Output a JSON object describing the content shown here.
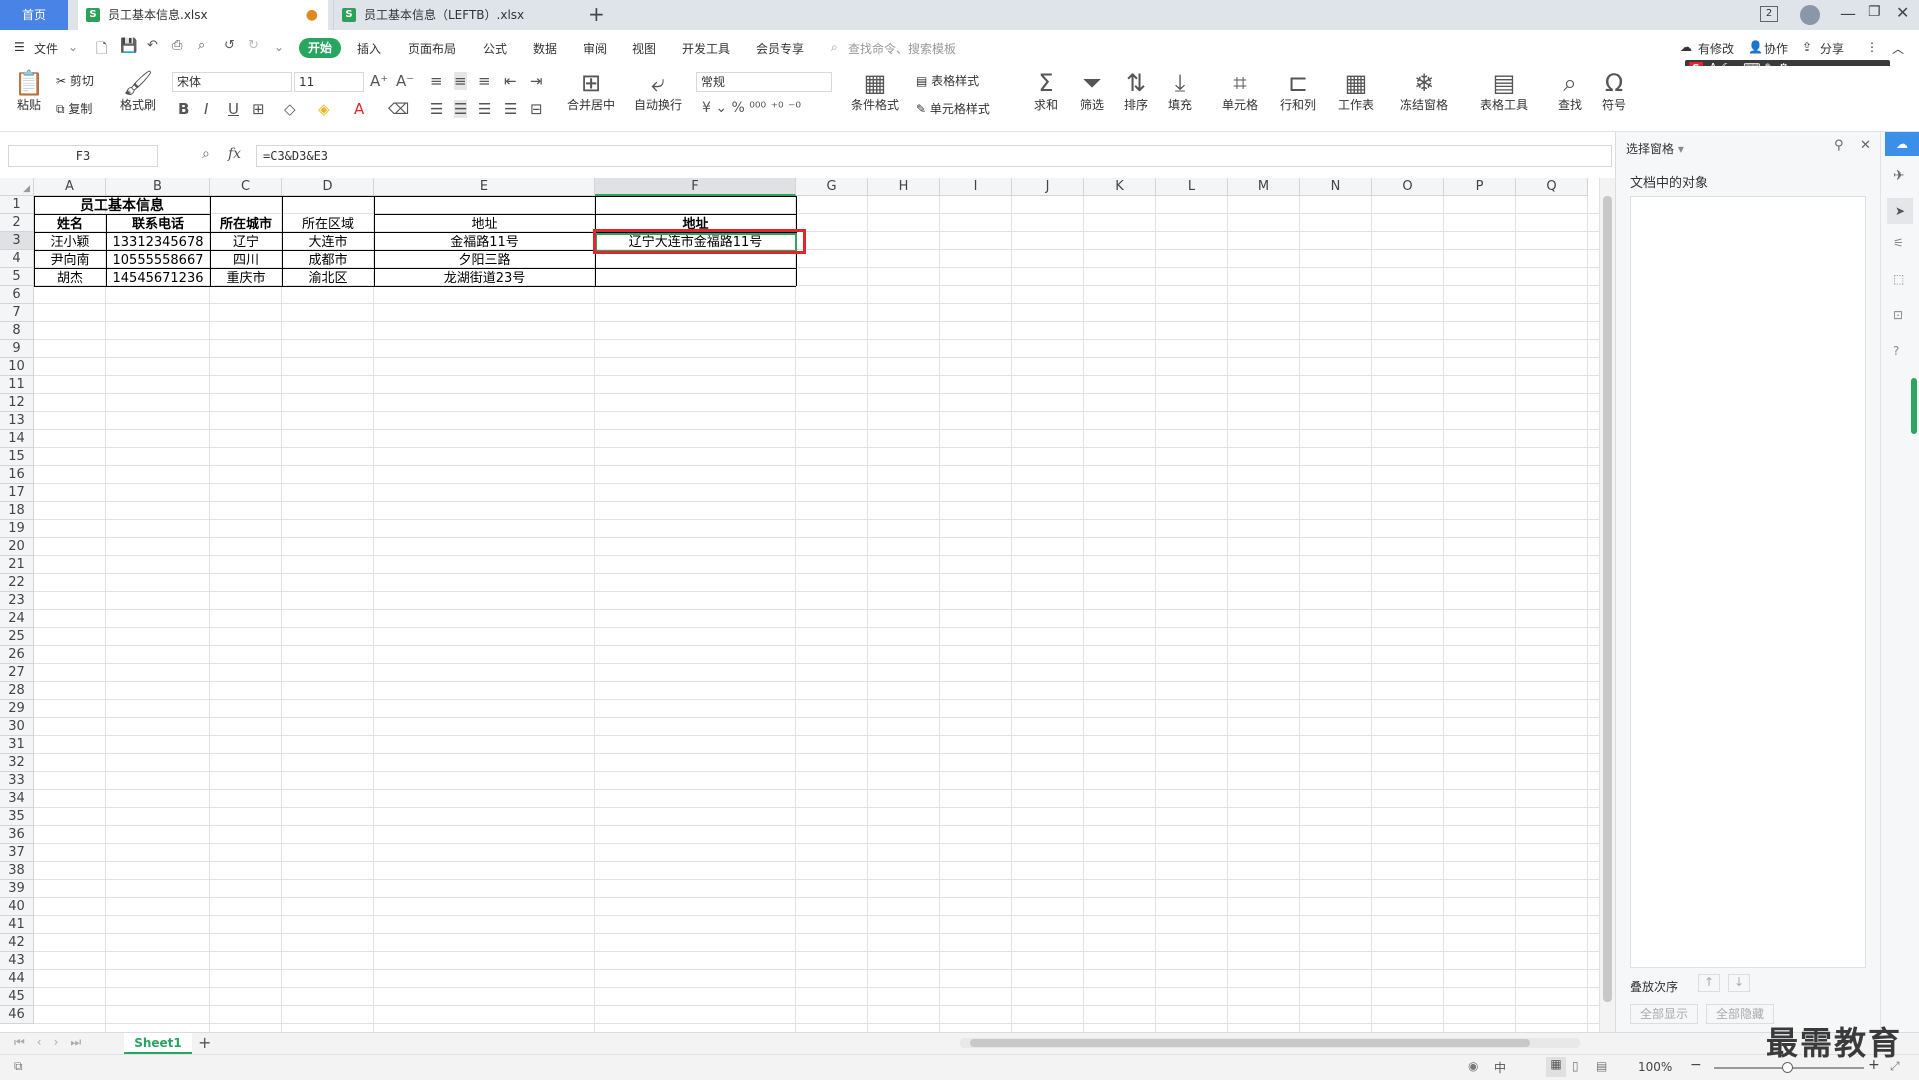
{
  "tabs": {
    "home": "首页",
    "doc1": "员工基本信息.xlsx",
    "doc2": "员工基本信息（LEFTB）.xlsx",
    "add": "+",
    "badge": "2"
  },
  "menu": {
    "file": "文件",
    "start": "开始",
    "items": [
      "插入",
      "页面布局",
      "公式",
      "数据",
      "审阅",
      "视图",
      "开发工具",
      "会员专享"
    ],
    "search_placeholder": "查找命令、搜索模板",
    "modified": "有修改",
    "collab": "协作",
    "share": "分享"
  },
  "ribbon": {
    "paste": "粘贴",
    "cut": "剪切",
    "copy": "复制",
    "format_painter": "格式刷",
    "font_name": "宋体",
    "font_size": "11",
    "merge": "合并居中",
    "wrap": "自动换行",
    "number_format": "常规",
    "cond_format": "条件格式",
    "table_style": "表格样式",
    "cell_style": "单元格样式",
    "sum": "求和",
    "filter": "筛选",
    "sort": "排序",
    "fill": "填充",
    "cell": "单元格",
    "rowcol": "行和列",
    "worksheet": "工作表",
    "freeze": "冻结窗格",
    "table_tools": "表格工具",
    "find": "查找",
    "symbol": "符号"
  },
  "formula": {
    "name_box": "F3",
    "fx": "fx",
    "content": "=C3&D3&E3"
  },
  "grid": {
    "columns": [
      "A",
      "B",
      "C",
      "D",
      "E",
      "F",
      "G",
      "H",
      "I",
      "J",
      "K",
      "L",
      "M",
      "N",
      "O",
      "P",
      "Q"
    ],
    "rows": [
      "1",
      "2",
      "3",
      "4",
      "5",
      "6",
      "7",
      "8",
      "9",
      "10",
      "11",
      "12",
      "13",
      "14",
      "15",
      "16",
      "17",
      "18",
      "19",
      "20",
      "21",
      "22",
      "23",
      "24",
      "25",
      "26",
      "27",
      "28",
      "29",
      "30",
      "31",
      "32",
      "33",
      "34",
      "35",
      "36",
      "37",
      "38",
      "39",
      "40",
      "41",
      "42",
      "43",
      "44",
      "45",
      "46"
    ],
    "title": "员工基本信息",
    "headers": [
      "姓名",
      "联系电话",
      "所在城市",
      "所在区域",
      "地址",
      "地址"
    ],
    "data": [
      [
        "汪小颖",
        "13312345678",
        "辽宁",
        "大连市",
        "金福路11号",
        "辽宁大连市金福路11号"
      ],
      [
        "尹向南",
        "10555558667",
        "四川",
        "成都市",
        "夕阳三路",
        ""
      ],
      [
        "胡杰",
        "14545671236",
        "重庆市",
        "渝北区",
        "龙湖街道23号",
        ""
      ]
    ]
  },
  "panel": {
    "title": "选择窗格",
    "objects_label": "文档中的对象",
    "order_label": "叠放次序",
    "show_all": "全部显示",
    "hide_all": "全部隐藏"
  },
  "sheets": {
    "active": "Sheet1",
    "add": "+"
  },
  "status": {
    "zoom": "100%",
    "lang": "中"
  },
  "watermark": "最需教育",
  "colors": {
    "accent_green": "#28a55f",
    "tab_blue": "#4a83e6",
    "highlight_red": "#e0262b",
    "selection_green": "#2ea55f"
  }
}
